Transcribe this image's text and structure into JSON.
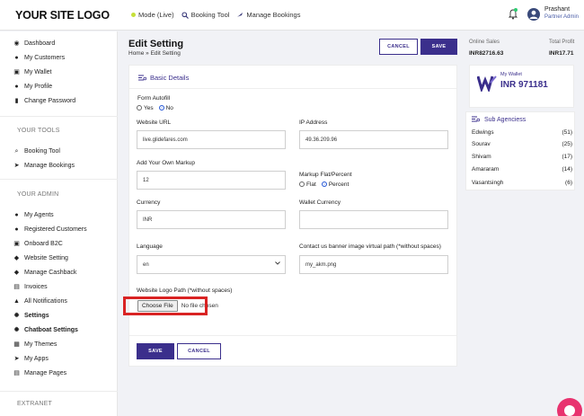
{
  "header": {
    "logo": "YOUR SITE LOGO",
    "nav": [
      {
        "label": "Mode (Live)",
        "icon": "live-dot-icon"
      },
      {
        "label": "Booking Tool",
        "icon": "search-icon"
      },
      {
        "label": "Manage Bookings",
        "icon": "plane-icon"
      }
    ],
    "user_name": "Prashant",
    "user_role": "Partner Admin"
  },
  "sidebar": {
    "main_items": [
      {
        "label": "Dashboard",
        "icon": "dashboard-icon"
      },
      {
        "label": "My Customers",
        "icon": "user-icon"
      },
      {
        "label": "My Wallet",
        "icon": "wallet-icon"
      },
      {
        "label": "My Profile",
        "icon": "profile-icon"
      },
      {
        "label": "Change Password",
        "icon": "lock-icon"
      }
    ],
    "tools_heading": "YOUR TOOLS",
    "tools_items": [
      {
        "label": "Booking Tool",
        "icon": "search-icon"
      },
      {
        "label": "Manage Bookings",
        "icon": "plane-icon"
      }
    ],
    "admin_heading": "YOUR ADMIN",
    "admin_items": [
      {
        "label": "My Agents",
        "icon": "agents-icon"
      },
      {
        "label": "Registered Customers",
        "icon": "customers-icon"
      },
      {
        "label": "Onboard B2C",
        "icon": "onboard-icon"
      },
      {
        "label": "Website Setting",
        "icon": "website-icon"
      },
      {
        "label": "Manage Cashback",
        "icon": "cashback-icon"
      },
      {
        "label": "Invoices",
        "icon": "invoice-icon"
      },
      {
        "label": "All Notifications",
        "icon": "bell-icon"
      },
      {
        "label": "Settings",
        "icon": "settings-icon"
      },
      {
        "label": "Chatboat Settings",
        "icon": "chat-settings-icon"
      },
      {
        "label": "My Themes",
        "icon": "themes-icon"
      },
      {
        "label": "My Apps",
        "icon": "apps-icon"
      },
      {
        "label": "Manage Pages",
        "icon": "pages-icon"
      }
    ],
    "extranet_heading": "EXTRANET"
  },
  "page": {
    "title": "Edit Setting",
    "breadcrumb": "Home » Edit Setting",
    "cancel_label": "CANCEL",
    "save_label": "SAVE"
  },
  "form": {
    "section_title": "Basic Details",
    "autofill_label": "Form Autofill",
    "autofill_yes": "Yes",
    "autofill_no": "No",
    "autofill_value": "No",
    "website_url_label": "Website URL",
    "website_url_value": "live.glidefares.com",
    "ip_label": "IP Address",
    "ip_value": "49.36.209.96",
    "markup_label": "Add Your Own Markup",
    "markup_value": "12",
    "markup_type_label": "Markup Flat/Percent",
    "markup_flat": "Flat",
    "markup_percent": "Percent",
    "markup_type_value": "Percent",
    "currency_label": "Currency",
    "currency_value": "INR",
    "wallet_currency_label": "Wallet Currency",
    "wallet_currency_value": "",
    "language_label": "Language",
    "language_value": "en",
    "banner_label": "Contact us banner image virtual path (*without spaces)",
    "banner_value": "my_akm.png",
    "logo_path_label": "Website Logo Path (*without spaces)",
    "choose_file_label": "Choose File",
    "no_file_label": "No file chosen",
    "save_label": "SAVE",
    "cancel_label": "CANCEL"
  },
  "stats": {
    "online_sales_label": "Online Sales",
    "online_sales_value": "INR82716.63",
    "total_profit_label": "Total Profit",
    "total_profit_value": "INR17.71",
    "wallet_label": "My Wallet",
    "wallet_value": "INR 971181"
  },
  "sub_agencies": {
    "title": "Sub Agenciess",
    "rows": [
      {
        "name": "Edwings",
        "count": "(51)"
      },
      {
        "name": "Sourav",
        "count": "(25)"
      },
      {
        "name": "Shivam",
        "count": "(17)"
      },
      {
        "name": "Amararam",
        "count": "(14)"
      },
      {
        "name": "Vasantsingh",
        "count": "(6)"
      }
    ]
  },
  "colors": {
    "accent": "#3b2f8c",
    "highlight": "#d92323",
    "live": "#c6e03a",
    "chat": "#e8336f"
  }
}
